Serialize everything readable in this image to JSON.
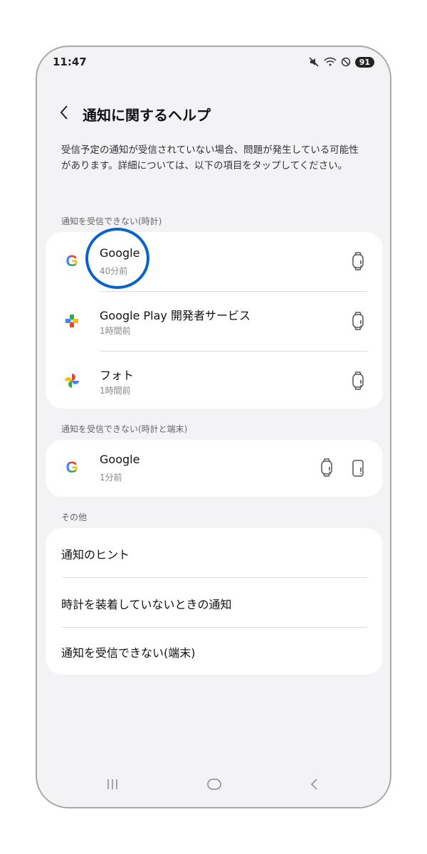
{
  "status_bar": {
    "time": "11:47",
    "battery": "91",
    "icons": [
      "mute-icon",
      "wifi-icon",
      "do-not-disturb-icon"
    ]
  },
  "header": {
    "title": "通知に関するヘルプ"
  },
  "description": "受信予定の通知が受信されていない場合、問題が発生している可能性があります。詳細については、以下の項目をタップしてください。",
  "section_watch": {
    "title": "通知を受信できない(時計)",
    "items": [
      {
        "name": "Google",
        "time": "40分前",
        "icon": "google-icon"
      },
      {
        "name": "Google Play 開発者サービス",
        "time": "1時間前",
        "icon": "google-play-services-icon"
      },
      {
        "name": "フォト",
        "time": "1時間前",
        "icon": "google-photos-icon"
      }
    ]
  },
  "section_watch_device": {
    "title": "通知を受信できない(時計と端末)",
    "items": [
      {
        "name": "Google",
        "time": "1分前",
        "icon": "google-icon"
      }
    ]
  },
  "section_other": {
    "title": "その他",
    "items": [
      {
        "label": "通知のヒント"
      },
      {
        "label": "時計を装着していないときの通知"
      },
      {
        "label": "通知を受信できない(端末)"
      }
    ]
  },
  "colors": {
    "highlight": "#0a64c8",
    "background": "#f3f3f5",
    "card": "#ffffff"
  }
}
